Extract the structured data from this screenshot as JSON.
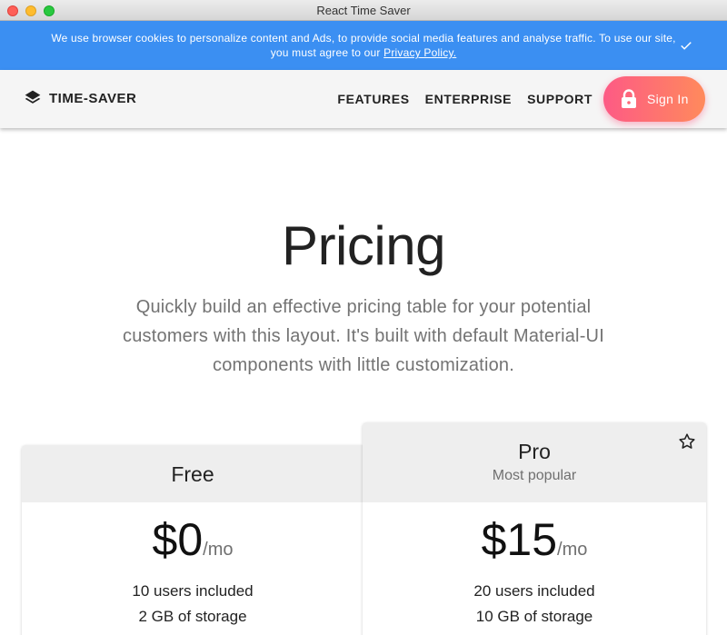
{
  "window": {
    "title": "React Time Saver"
  },
  "cookie_banner": {
    "text": "We use browser cookies to personalize content and Ads, to provide social media features and analyse traffic. To use our site, you must agree to our ",
    "link_text": "Privacy Policy."
  },
  "appbar": {
    "brand": "TIME-SAVER",
    "nav": [
      "FEATURES",
      "ENTERPRISE",
      "SUPPORT"
    ],
    "signin_label": "Sign In"
  },
  "hero": {
    "title": "Pricing",
    "subtitle": "Quickly build an effective pricing table for your potential customers with this layout. It's built with default Material-UI components with little customization."
  },
  "tiers": [
    {
      "title": "Free",
      "price": "$0",
      "per": "/mo",
      "features": [
        "10 users included",
        "2 GB of storage"
      ]
    },
    {
      "title": "Pro",
      "subtitle": "Most popular",
      "price": "$15",
      "per": "/mo",
      "features": [
        "20 users included",
        "10 GB of storage"
      ]
    }
  ],
  "colors": {
    "banner": "#3b8ff2",
    "appbar": "#f5f5f5",
    "signin_start": "#fd5a85",
    "signin_end": "#ff8a5c"
  },
  "icons": [
    "layers-icon",
    "check-icon",
    "lock-icon",
    "star-outline-icon"
  ]
}
